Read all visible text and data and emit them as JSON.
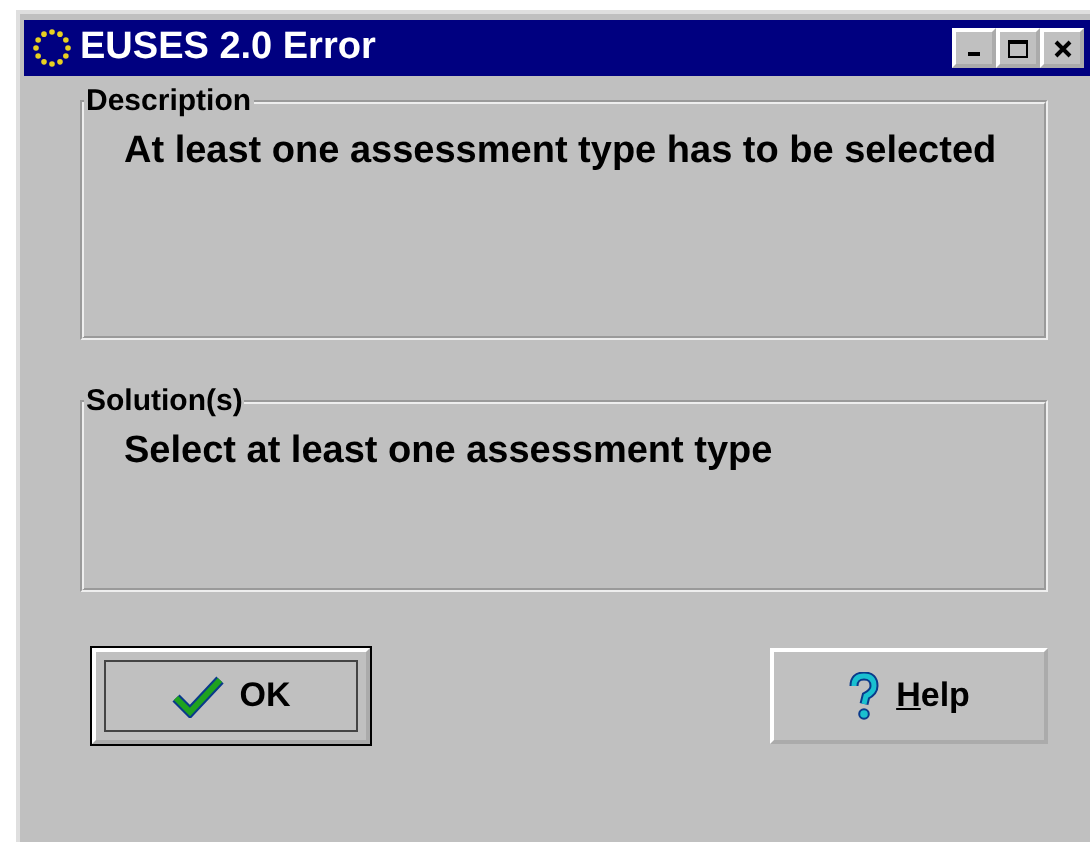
{
  "window": {
    "title": "EUSES 2.0 Error"
  },
  "groups": [
    {
      "legend": "Description",
      "text": "At least one assessment type has to be selected"
    },
    {
      "legend": "Solution(s)",
      "text": "Select at least one assessment type"
    }
  ],
  "buttons": [
    {
      "kind": "ok",
      "label": "OK",
      "focused": true
    },
    {
      "kind": "help",
      "label": "Help",
      "focused": false
    }
  ]
}
